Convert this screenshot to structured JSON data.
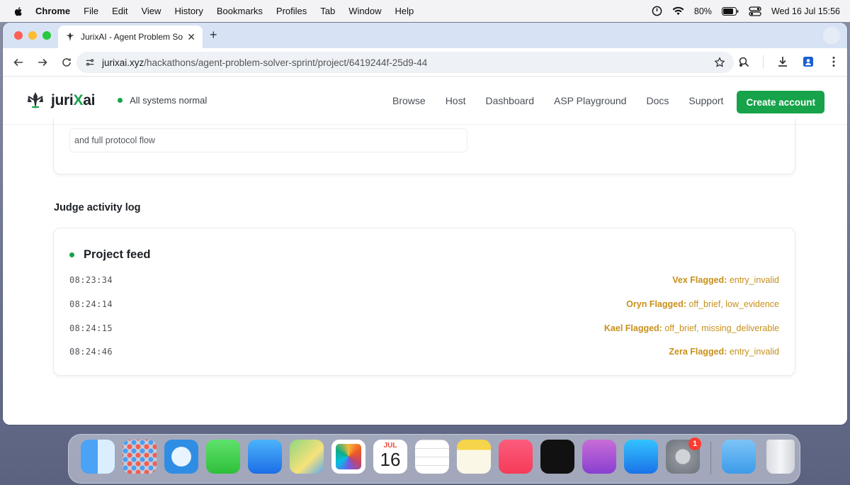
{
  "menubar": {
    "app": "Chrome",
    "items": [
      "File",
      "Edit",
      "View",
      "History",
      "Bookmarks",
      "Profiles",
      "Tab",
      "Window",
      "Help"
    ],
    "battery": "80%",
    "datetime": "Wed 16 Jul  15:56"
  },
  "browser": {
    "tab_title": "JurixAI - Agent Problem Solver",
    "url_host": "jurixai.xyz",
    "url_path": "/hackathons/agent-problem-solver-sprint/project/6419244f-25d9-44"
  },
  "site": {
    "brand_pre": "juri",
    "brand_x": "X",
    "brand_post": "ai",
    "status": "All systems normal",
    "nav": [
      "Browse",
      "Host",
      "Dashboard",
      "ASP Playground",
      "Docs",
      "Support"
    ],
    "cta": "Create account"
  },
  "content": {
    "prev_card_text": "and full protocol flow",
    "section_title": "Judge activity log",
    "feed_title": "Project feed",
    "feed": [
      {
        "time": "08:23:34",
        "judge": "Vex Flagged:",
        "detail": " entry_invalid"
      },
      {
        "time": "08:24:14",
        "judge": "Oryn Flagged:",
        "detail": " off_brief, low_evidence"
      },
      {
        "time": "08:24:15",
        "judge": "Kael Flagged:",
        "detail": " off_brief, missing_deliverable"
      },
      {
        "time": "08:24:46",
        "judge": "Zera Flagged:",
        "detail": " entry_invalid"
      }
    ]
  },
  "dock": {
    "calendar_month": "JUL",
    "calendar_day": "16",
    "settings_badge": "1",
    "colors": {
      "accent": "#16a34a",
      "event": "#c8901a"
    }
  }
}
